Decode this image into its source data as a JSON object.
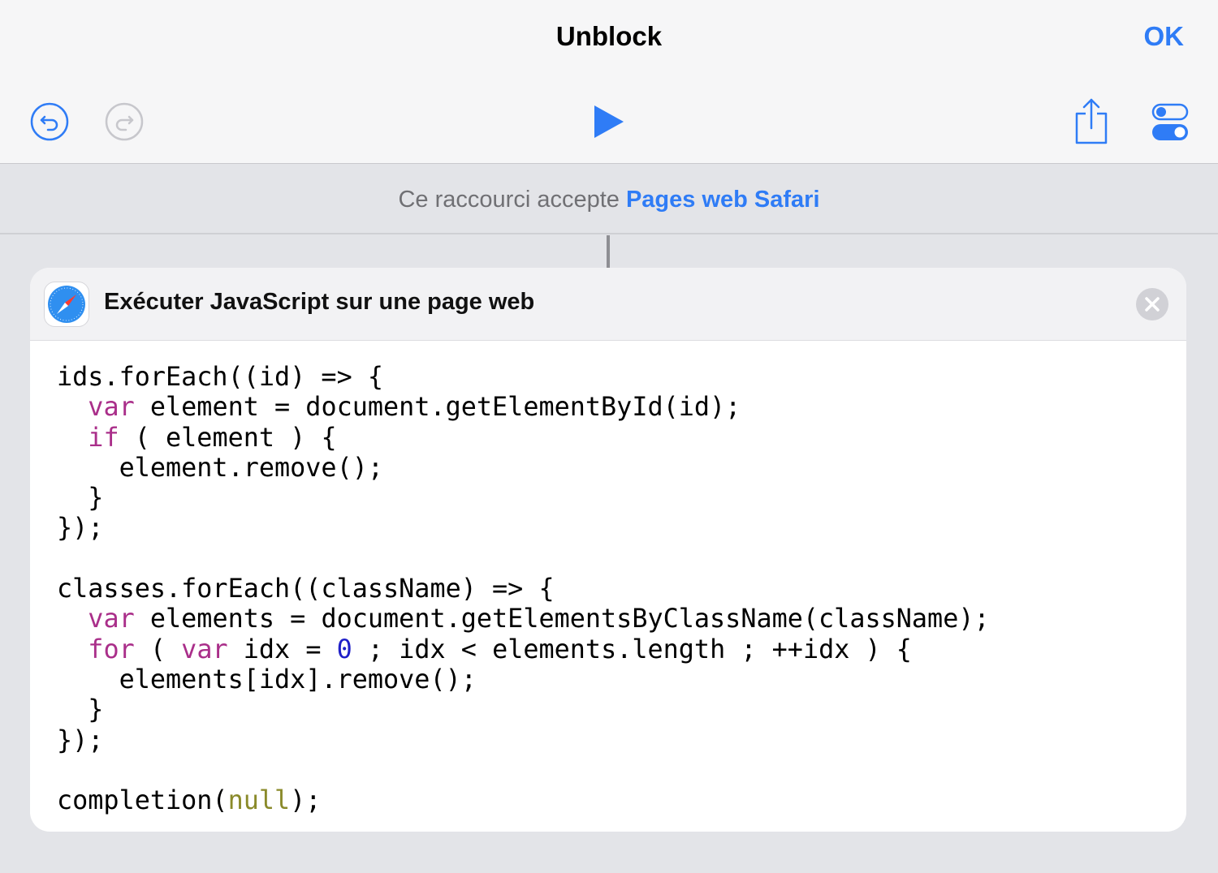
{
  "header": {
    "title": "Unblock",
    "ok_label": "OK"
  },
  "toolbar": {
    "icons": [
      "undo-icon",
      "redo-icon",
      "play-icon",
      "share-icon",
      "settings-toggle-icon"
    ],
    "accent_color": "#2f7cf6",
    "disabled_color": "#c7c7cc"
  },
  "input_bar": {
    "static_text": "Ce raccourci accepte",
    "link_text": "Pages web Safari"
  },
  "action_card": {
    "icon": "safari-compass-icon",
    "title": "Exécuter JavaScript sur une page web",
    "close_icon": "close-icon",
    "code_lines": [
      [
        {
          "t": "ids.forEach((id) => {"
        }
      ],
      [
        {
          "t": "  "
        },
        {
          "t": "var",
          "c": "kw"
        },
        {
          "t": " element = document.getElementById(id);"
        }
      ],
      [
        {
          "t": "  "
        },
        {
          "t": "if",
          "c": "kw"
        },
        {
          "t": " ( element ) {"
        }
      ],
      [
        {
          "t": "    element.remove();"
        }
      ],
      [
        {
          "t": "  }"
        }
      ],
      [
        {
          "t": "});"
        }
      ],
      [
        {
          "t": ""
        }
      ],
      [
        {
          "t": "classes.forEach((className) => {"
        }
      ],
      [
        {
          "t": "  "
        },
        {
          "t": "var",
          "c": "kw"
        },
        {
          "t": " elements = document.getElementsByClassName(className);"
        }
      ],
      [
        {
          "t": "  "
        },
        {
          "t": "for",
          "c": "kw"
        },
        {
          "t": " ( "
        },
        {
          "t": "var",
          "c": "kw"
        },
        {
          "t": " idx = "
        },
        {
          "t": "0",
          "c": "num"
        },
        {
          "t": " ; idx < elements.length ; ++idx ) {"
        }
      ],
      [
        {
          "t": "    elements[idx].remove();"
        }
      ],
      [
        {
          "t": "  }"
        }
      ],
      [
        {
          "t": "});"
        }
      ],
      [
        {
          "t": ""
        }
      ],
      [
        {
          "t": "completion("
        },
        {
          "t": "null",
          "c": "lit"
        },
        {
          "t": ");"
        }
      ]
    ],
    "syntax_colors": {
      "keyword": "#aa2f8a",
      "number": "#2020c8",
      "literal": "#8a8a2a"
    }
  }
}
